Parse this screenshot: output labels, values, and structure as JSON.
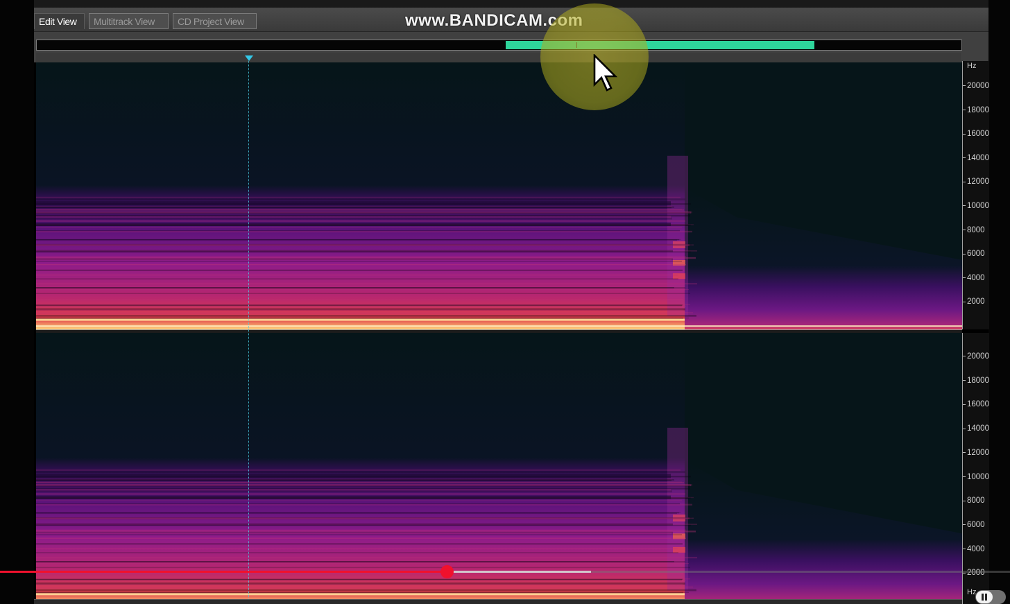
{
  "tabs": [
    {
      "label": "Edit View",
      "active": true
    },
    {
      "label": "Multitrack View",
      "active": false
    },
    {
      "label": "CD Project View",
      "active": false
    }
  ],
  "watermark": "www.BANDICAM.com",
  "frequency_axis": {
    "unit": "Hz",
    "top_channel_ticks": [
      "20000",
      "18000",
      "16000",
      "14000",
      "12000",
      "10000",
      "8000",
      "6000",
      "4000",
      "2000"
    ],
    "bottom_channel_ticks": [
      "20000",
      "18000",
      "16000",
      "14000",
      "12000",
      "10000",
      "8000",
      "6000",
      "4000",
      "2000"
    ],
    "bottom_channel_unit": "Hz"
  },
  "overview": {
    "visible_start_fraction": 0.507,
    "visible_end_fraction": 0.841
  },
  "video_player": {
    "played_fraction": 0.442,
    "buffered_fraction": 0.585
  },
  "colors": {
    "overview_window": "#2ed59b",
    "progress_played": "#f0112d",
    "playhead": "#33c8e8",
    "spectrogram_bg": "#061519"
  }
}
